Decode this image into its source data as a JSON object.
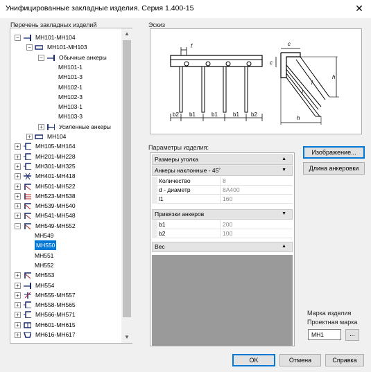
{
  "window": {
    "title": "Унифицированные закладные изделия. Серия 1.400-15",
    "close_glyph": "✕"
  },
  "labels": {
    "tree": "Перечень закладных изделий",
    "sketch": "Эскиз",
    "params": "Параметры изделия:",
    "mark_group": "Марка изделия",
    "project_mark": "Проектная марка"
  },
  "tree": [
    {
      "label": "МН101-МН104",
      "expander": "−"
    },
    {
      "label": "МН101-МН103",
      "expander": "−"
    },
    {
      "label": "Обычные анкеры",
      "expander": "−"
    },
    {
      "label": "МН101-1"
    },
    {
      "label": "МН101-3"
    },
    {
      "label": "МН102-1"
    },
    {
      "label": "МН102-3"
    },
    {
      "label": "МН103-1"
    },
    {
      "label": "МН103-3"
    },
    {
      "label": "Усиленные анкеры",
      "expander": "+"
    },
    {
      "label": "МН104",
      "expander": "+"
    },
    {
      "label": "МН105-МН164",
      "expander": "+"
    },
    {
      "label": "МН201-МН228",
      "expander": "+"
    },
    {
      "label": "МН301-МН325",
      "expander": "+"
    },
    {
      "label": "МН401-МН418",
      "expander": "+"
    },
    {
      "label": "МН501-МН522",
      "expander": "+"
    },
    {
      "label": "МН523-МН538",
      "expander": "+"
    },
    {
      "label": "МН539-МН540",
      "expander": "+"
    },
    {
      "label": "МН541-МН548",
      "expander": "+"
    },
    {
      "label": "МН549-МН552",
      "expander": "−"
    },
    {
      "label": "МН549"
    },
    {
      "label": "МН550",
      "selected": true
    },
    {
      "label": "МН551"
    },
    {
      "label": "МН552"
    },
    {
      "label": "МН553",
      "expander": "+"
    },
    {
      "label": "МН554",
      "expander": "+"
    },
    {
      "label": "МН555-МН557",
      "expander": "+"
    },
    {
      "label": "МН558-МН565",
      "expander": "+"
    },
    {
      "label": "МН566-МН571",
      "expander": "+"
    },
    {
      "label": "МН601-МН615",
      "expander": "+"
    },
    {
      "label": "МН616-МН617",
      "expander": "+"
    }
  ],
  "sketch": {
    "dims": {
      "f": "f",
      "c": "c",
      "h": "h",
      "l": "l",
      "b1": "b1",
      "b2": "b2"
    }
  },
  "params": {
    "groups": [
      {
        "title": "Размеры уголка",
        "arrow": "▲",
        "rows": []
      },
      {
        "title": "Анкеры наклонные - 45˚",
        "arrow": "▼",
        "rows": [
          {
            "key": "Количество",
            "value": "8"
          },
          {
            "key": "d - диаметр",
            "value": "8А400"
          },
          {
            "key": "l1",
            "value": "160"
          }
        ]
      },
      {
        "title": "Привязки анкеров",
        "arrow": "▼",
        "rows": [
          {
            "key": "b1",
            "value": "200"
          },
          {
            "key": "b2",
            "value": "100"
          }
        ]
      },
      {
        "title": "Вес",
        "arrow": "▲",
        "rows": []
      }
    ]
  },
  "buttons": {
    "image": "Изображение...",
    "anchor_length": "Длина анкеровки",
    "ok": "OK",
    "cancel": "Отмена",
    "help": "Справка",
    "browse": "..."
  },
  "mark": {
    "value": "МН1"
  },
  "scroll": {
    "up": "▲",
    "down": "▼"
  }
}
